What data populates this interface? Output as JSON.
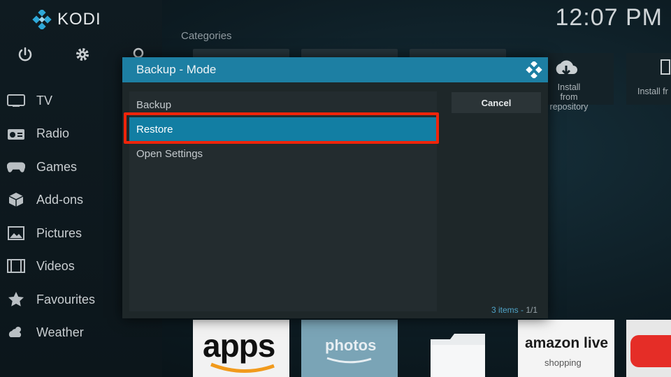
{
  "app": {
    "name": "KODI",
    "clock": "12:07 PM"
  },
  "sidebar": {
    "items": [
      {
        "label": "TV",
        "icon": "tv-icon"
      },
      {
        "label": "Radio",
        "icon": "radio-icon"
      },
      {
        "label": "Games",
        "icon": "gamepad-icon"
      },
      {
        "label": "Add-ons",
        "icon": "addons-box-icon"
      },
      {
        "label": "Pictures",
        "icon": "picture-icon"
      },
      {
        "label": "Videos",
        "icon": "film-icon"
      },
      {
        "label": "Favourites",
        "icon": "star-icon"
      },
      {
        "label": "Weather",
        "icon": "weather-icon"
      }
    ]
  },
  "main": {
    "categories_label": "Categories",
    "right_tiles": [
      {
        "line1": "Install from",
        "line2": "repository"
      },
      {
        "line1": "Install fr",
        "line2": ""
      }
    ],
    "apps": [
      {
        "label": "apps"
      },
      {
        "label": "photos"
      },
      {
        "label": ""
      },
      {
        "label": "amazon live",
        "sublabel": "shopping"
      },
      {
        "label": ""
      }
    ]
  },
  "dialog": {
    "title": "Backup - Mode",
    "options": [
      {
        "label": "Backup",
        "selected": false
      },
      {
        "label": "Restore",
        "selected": true
      },
      {
        "label": "Open Settings",
        "selected": false
      }
    ],
    "cancel_label": "Cancel",
    "items_count": "3 items - ",
    "page": "1/1"
  },
  "colors": {
    "accent": "#1d7fa3",
    "selection": "#127ea3",
    "highlight_border": "#f0240a"
  }
}
